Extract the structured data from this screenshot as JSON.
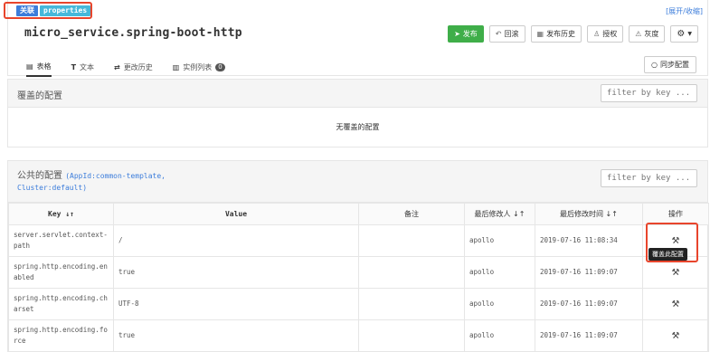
{
  "badges": {
    "link": "关联",
    "format": "properties"
  },
  "expand_toggle": "[展开/收缩]",
  "namespace_title": "micro_service.spring-boot-http",
  "toolbar": {
    "publish": "发布",
    "rollback": "回滚",
    "history": "发布历史",
    "authorize": "授权",
    "gray": "灰度",
    "settings_icon": "gear-icon"
  },
  "tabs": [
    {
      "label": "表格",
      "icon": "table-icon",
      "active": true
    },
    {
      "label": "文本",
      "icon": "text-icon",
      "active": false
    },
    {
      "label": "更改历史",
      "icon": "history-icon",
      "active": false
    },
    {
      "label": "实例列表",
      "icon": "list-icon",
      "count": "0",
      "active": false
    }
  ],
  "sync_button": "同步配置",
  "override_section": {
    "title": "覆盖的配置",
    "filter_placeholder": "filter by key ...",
    "empty": "无覆盖的配置"
  },
  "public_section": {
    "title": "公共的配置",
    "appid_line1": "(AppId:common-template,",
    "appid_line2": "Cluster:default)",
    "filter_placeholder": "filter by key ..."
  },
  "table": {
    "headers": [
      "Key ↓↑",
      "Value",
      "备注",
      "最后修改人 ↓↑",
      "最后修改时间 ↓↑",
      "操作"
    ],
    "rows": [
      {
        "key": "server.servlet.context-path",
        "value": "/",
        "comment": "",
        "modifier": "apollo",
        "time": "2019-07-16 11:08:34"
      },
      {
        "key": "spring.http.encoding.enabled",
        "value": "true",
        "comment": "",
        "modifier": "apollo",
        "time": "2019-07-16 11:09:07"
      },
      {
        "key": "spring.http.encoding.charset",
        "value": "UTF-8",
        "comment": "",
        "modifier": "apollo",
        "time": "2019-07-16 11:09:07"
      },
      {
        "key": "spring.http.encoding.force",
        "value": "true",
        "comment": "",
        "modifier": "apollo",
        "time": "2019-07-16 11:09:07"
      }
    ]
  },
  "tooltip": "覆盖此配置",
  "colors": {
    "publish": "#3fae49",
    "link_badge": "#3c7ddb",
    "props_badge": "#46b8da",
    "highlight": "#e8452c"
  }
}
